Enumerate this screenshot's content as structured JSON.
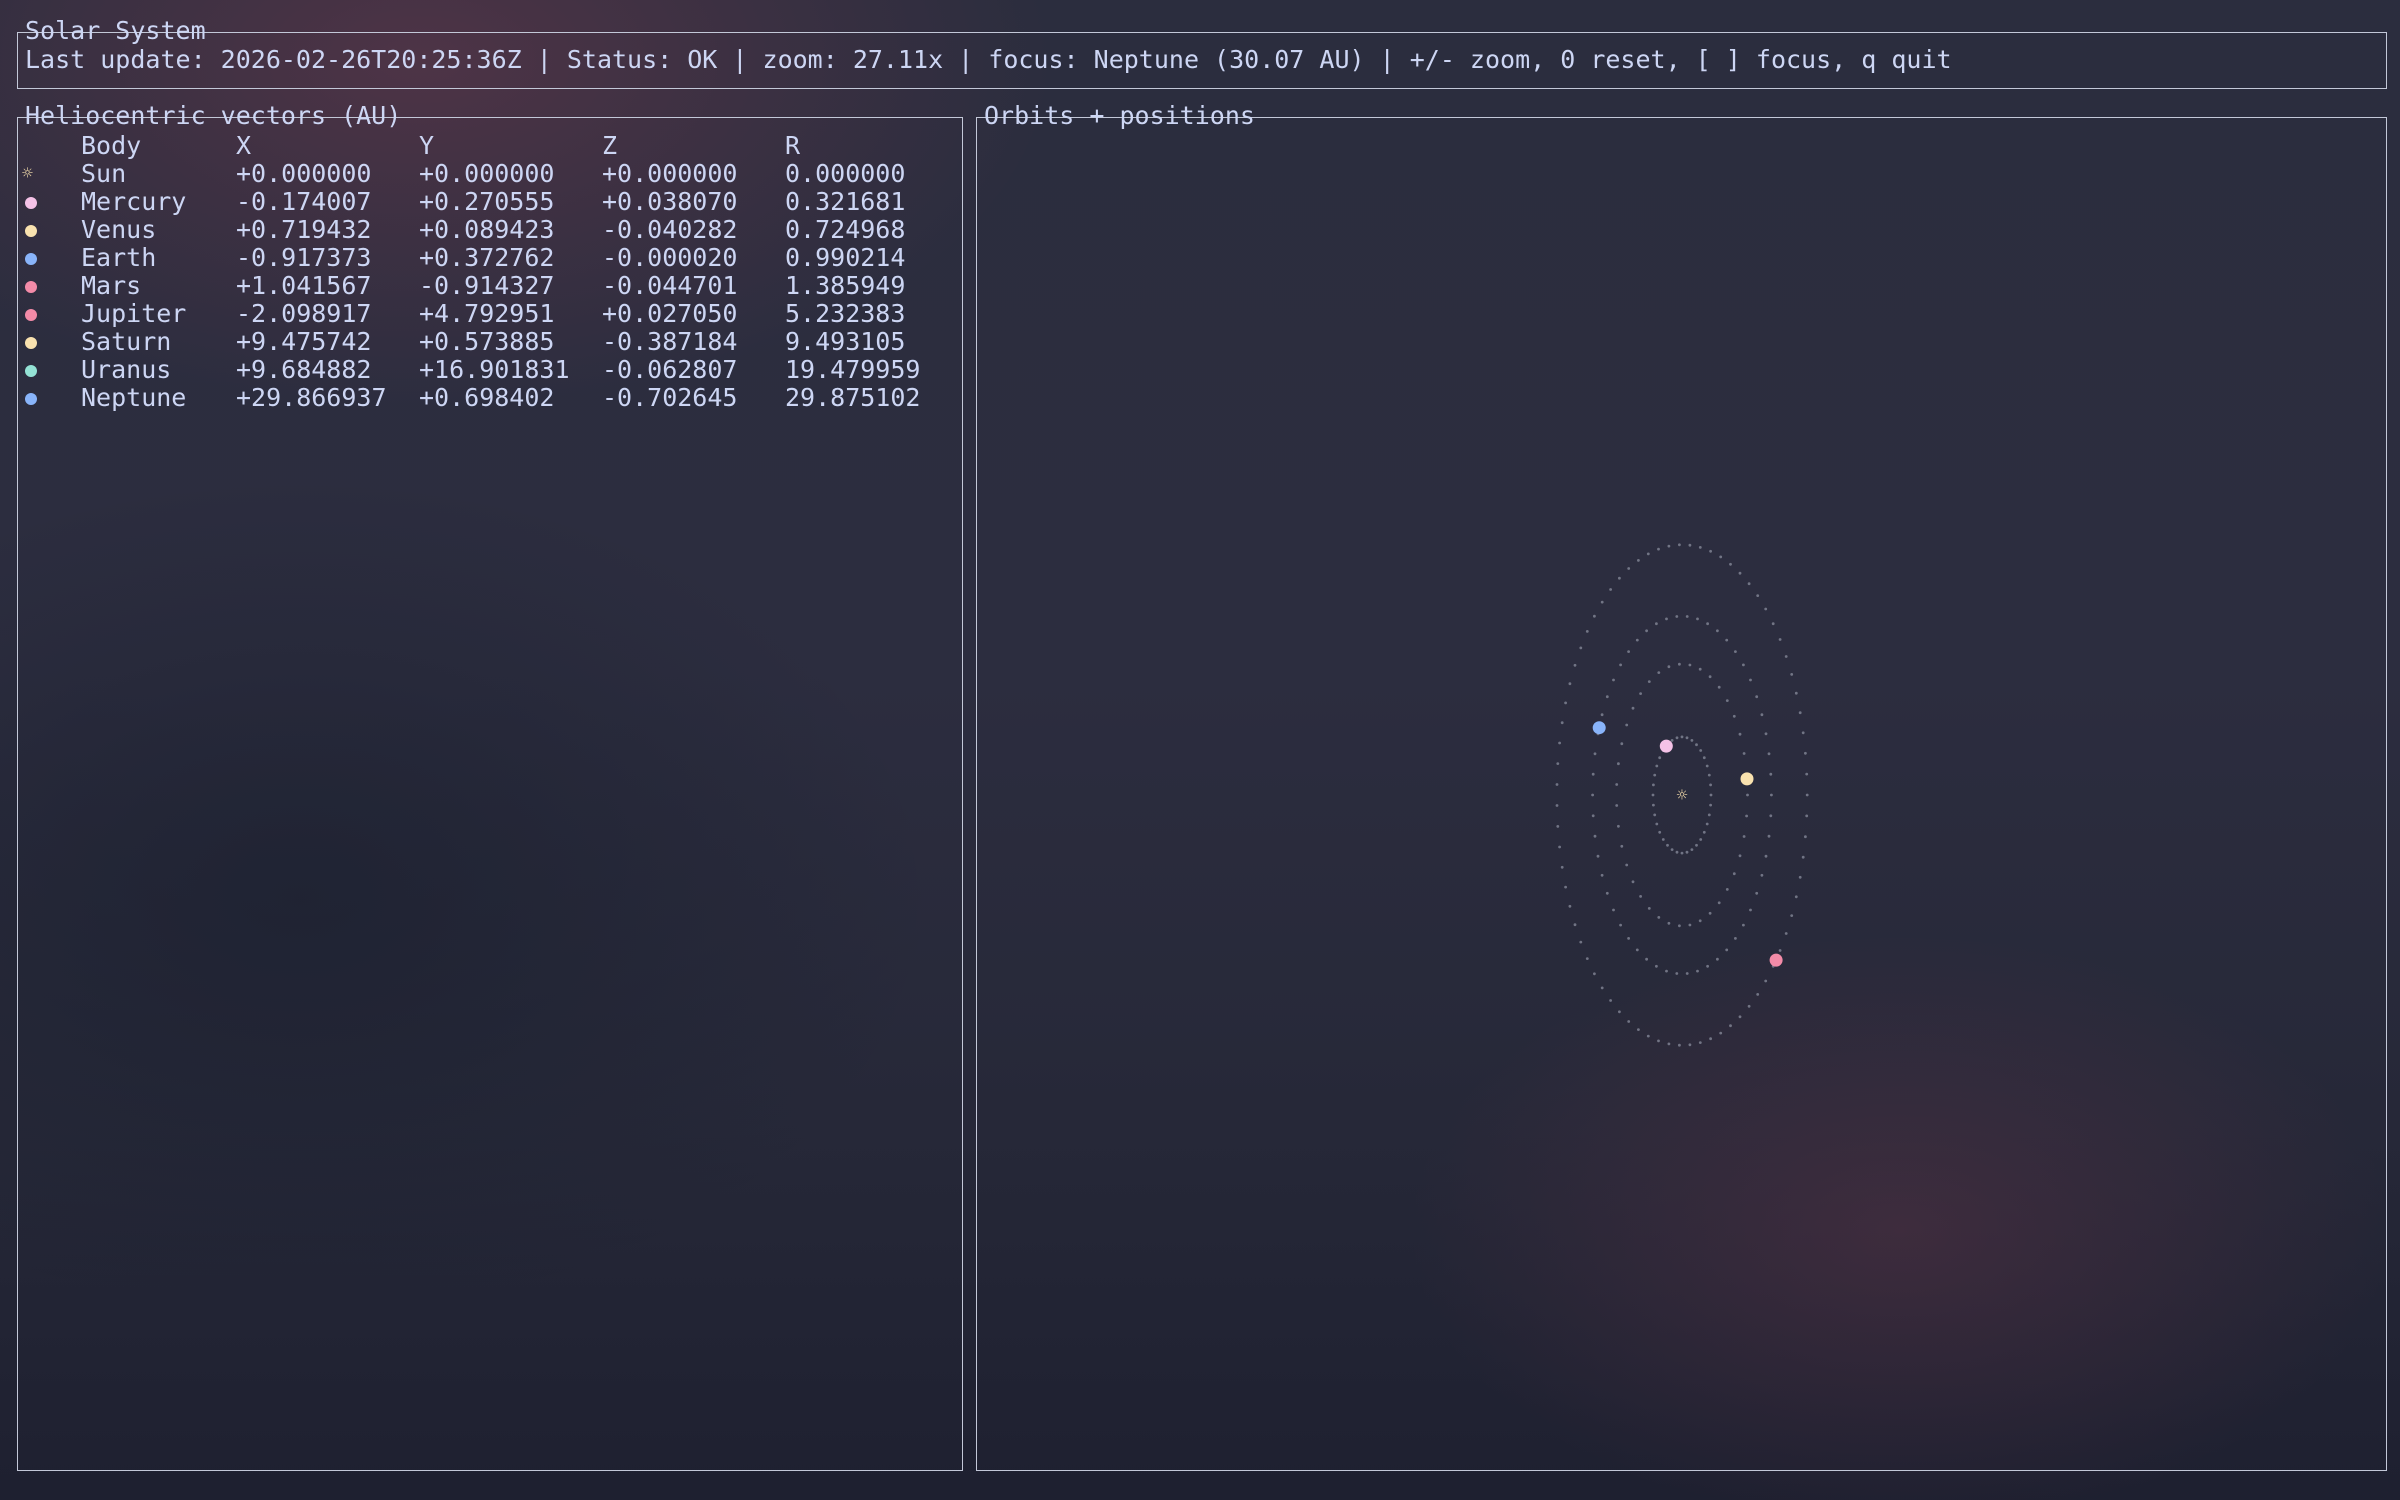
{
  "header": {
    "title": "Solar System",
    "status_line": "Last update: 2026-02-26T20:25:36Z | Status: OK | zoom: 27.11x | focus: Neptune (30.07 AU) | +/- zoom, 0 reset, [ ] focus, q quit"
  },
  "table": {
    "title": "Heliocentric vectors (AU)",
    "columns": {
      "body": "Body",
      "x": "X",
      "y": "Y",
      "z": "Z",
      "r": "R"
    },
    "rows": [
      {
        "name": "Sun",
        "x": "+0.000000",
        "y": "+0.000000",
        "z": "+0.000000",
        "r": "0.000000",
        "color": "#f9e2af",
        "icon": "sun-icon",
        "glyph": "☼"
      },
      {
        "name": "Mercury",
        "x": "-0.174007",
        "y": "+0.270555",
        "z": "+0.038070",
        "r": "0.321681",
        "color": "#f5c2e7",
        "icon": "dot-icon"
      },
      {
        "name": "Venus",
        "x": "+0.719432",
        "y": "+0.089423",
        "z": "-0.040282",
        "r": "0.724968",
        "color": "#f9e2af",
        "icon": "dot-icon"
      },
      {
        "name": "Earth",
        "x": "-0.917373",
        "y": "+0.372762",
        "z": "-0.000020",
        "r": "0.990214",
        "color": "#89b4fa",
        "icon": "dot-icon"
      },
      {
        "name": "Mars",
        "x": "+1.041567",
        "y": "-0.914327",
        "z": "-0.044701",
        "r": "1.385949",
        "color": "#f38ba8",
        "icon": "dot-icon"
      },
      {
        "name": "Jupiter",
        "x": "-2.098917",
        "y": "+4.792951",
        "z": "+0.027050",
        "r": "5.232383",
        "color": "#f38ba8",
        "icon": "dot-icon"
      },
      {
        "name": "Saturn",
        "x": "+9.475742",
        "y": "+0.573885",
        "z": "-0.387184",
        "r": "9.493105",
        "color": "#f9e2af",
        "icon": "dot-icon"
      },
      {
        "name": "Uranus",
        "x": "+9.684882",
        "y": "+16.901831",
        "z": "-0.062807",
        "r": "19.479959",
        "color": "#94e2d5",
        "icon": "dot-icon"
      },
      {
        "name": "Neptune",
        "x": "+29.866937",
        "y": "+0.698402",
        "z": "-0.702645",
        "r": "29.875102",
        "color": "#89b4fa",
        "icon": "dot-icon"
      }
    ]
  },
  "orbits": {
    "title": "Orbits + positions",
    "orbit_dot_color": "#8a8d9e",
    "sun_color": "#f9e2af",
    "bodies_shown": [
      {
        "name": "Mercury",
        "color": "#f5c2e7"
      },
      {
        "name": "Venus",
        "color": "#f9e2af"
      },
      {
        "name": "Earth",
        "color": "#89b4fa"
      },
      {
        "name": "Mars",
        "color": "#f38ba8"
      }
    ]
  }
}
